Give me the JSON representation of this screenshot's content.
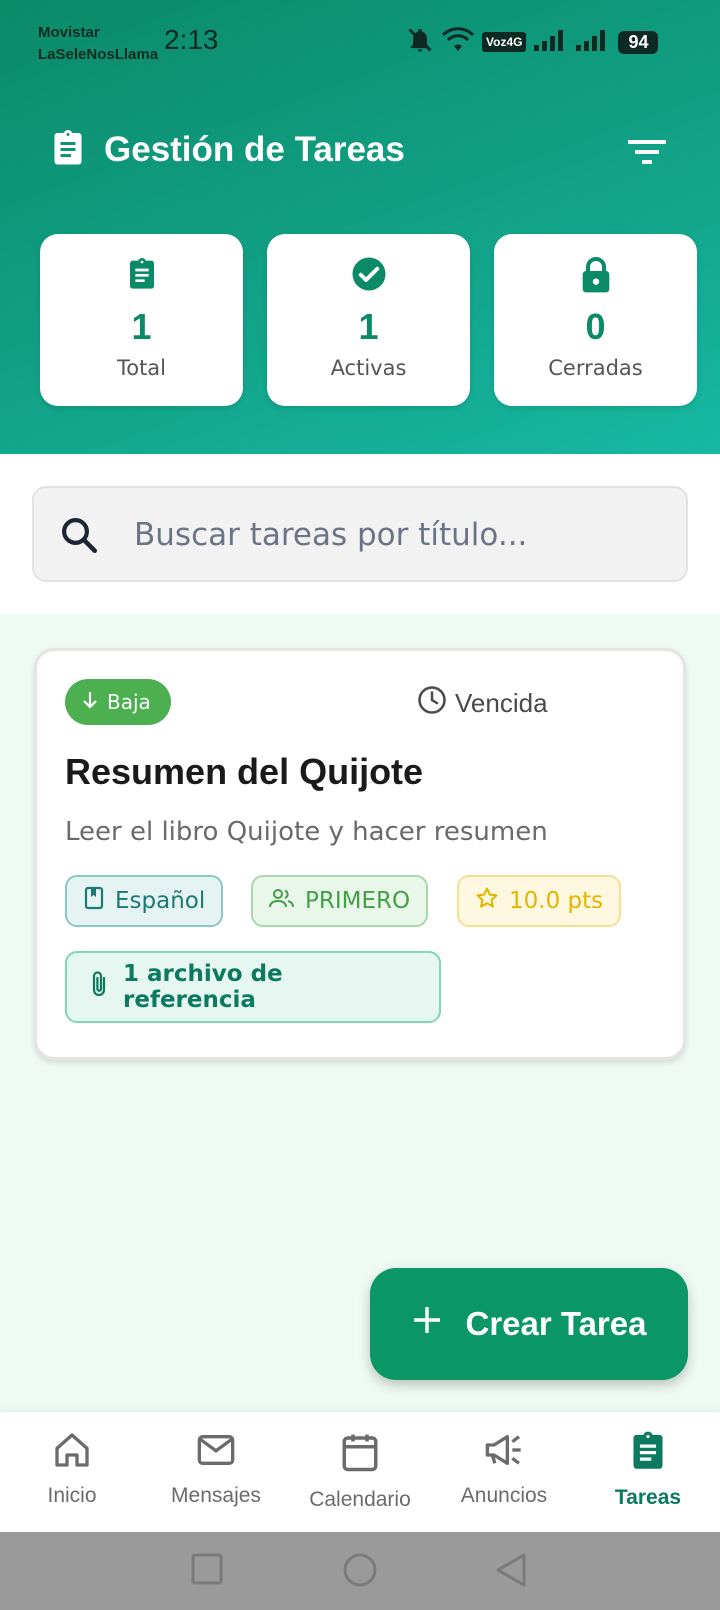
{
  "status_bar": {
    "carrier_line1": "Movistar",
    "carrier_line2": "LaSeleNosLlama",
    "time": "2:13",
    "network_badge": "Voz4G",
    "battery": "94"
  },
  "header": {
    "title": "Gestión de Tareas",
    "title_icon": "clipboard-icon",
    "filter_icon": "filter-icon"
  },
  "stats": [
    {
      "icon": "clipboard-icon",
      "value": "1",
      "label": "Total"
    },
    {
      "icon": "check-circle-icon",
      "value": "1",
      "label": "Activas"
    },
    {
      "icon": "lock-icon",
      "value": "0",
      "label": "Cerradas"
    }
  ],
  "search": {
    "placeholder": "Buscar tareas por título..."
  },
  "tasks": [
    {
      "priority": "Baja",
      "status": "Vencida",
      "title": "Resumen del Quijote",
      "description": "Leer el libro Quijote y hacer resumen",
      "subject": "Español",
      "group": "PRIMERO",
      "points": "10.0 pts",
      "attachments": "1 archivo de referencia"
    }
  ],
  "fab": {
    "label": "Crear Tarea"
  },
  "bottom_nav": [
    {
      "label": "Inicio",
      "icon": "home-icon",
      "active": false
    },
    {
      "label": "Mensajes",
      "icon": "mail-icon",
      "active": false
    },
    {
      "label": "Calendario",
      "icon": "calendar-icon",
      "active": false
    },
    {
      "label": "Anuncios",
      "icon": "megaphone-icon",
      "active": false
    },
    {
      "label": "Tareas",
      "icon": "clipboard-icon",
      "active": true
    }
  ],
  "colors": {
    "primary": "#0b8a68",
    "accent": "#0a9666",
    "background_content": "#eefaf3",
    "priority_low": "#4caf50"
  }
}
